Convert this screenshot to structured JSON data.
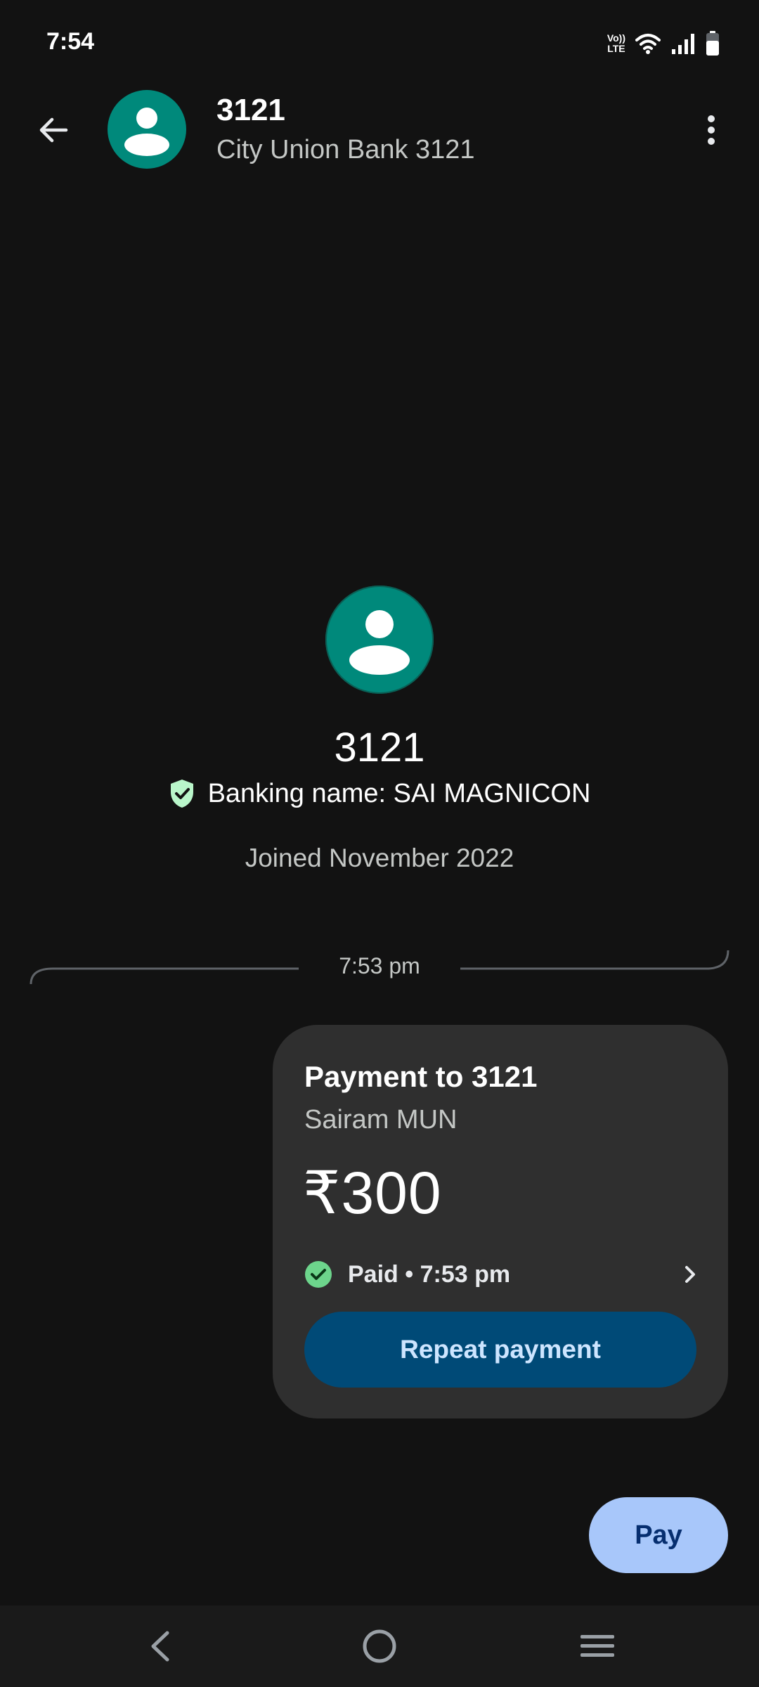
{
  "status_bar": {
    "time": "7:54",
    "volte_top": "Vo))",
    "volte_bottom": "LTE",
    "icons": [
      "volte-icon",
      "wifi-icon",
      "signal-icon",
      "battery-icon"
    ]
  },
  "header": {
    "title": "3121",
    "subtitle": "City Union Bank 3121"
  },
  "profile": {
    "name": "3121",
    "banking_name": "Banking name: SAI MAGNICON",
    "joined": "Joined November 2022"
  },
  "timeline": {
    "time": "7:53 pm"
  },
  "payment_card": {
    "title": "Payment to 3121",
    "subtitle": "Sairam MUN",
    "amount": "₹300",
    "status": "Paid • 7:53 pm",
    "repeat_label": "Repeat payment"
  },
  "pay_button": {
    "label": "Pay"
  },
  "colors": {
    "background": "#121212",
    "avatar": "#00897b",
    "card": "#2f2f2f",
    "repeat_button": "#004a77",
    "pay_button": "#a8c7fa",
    "success": "#6dd58c"
  }
}
